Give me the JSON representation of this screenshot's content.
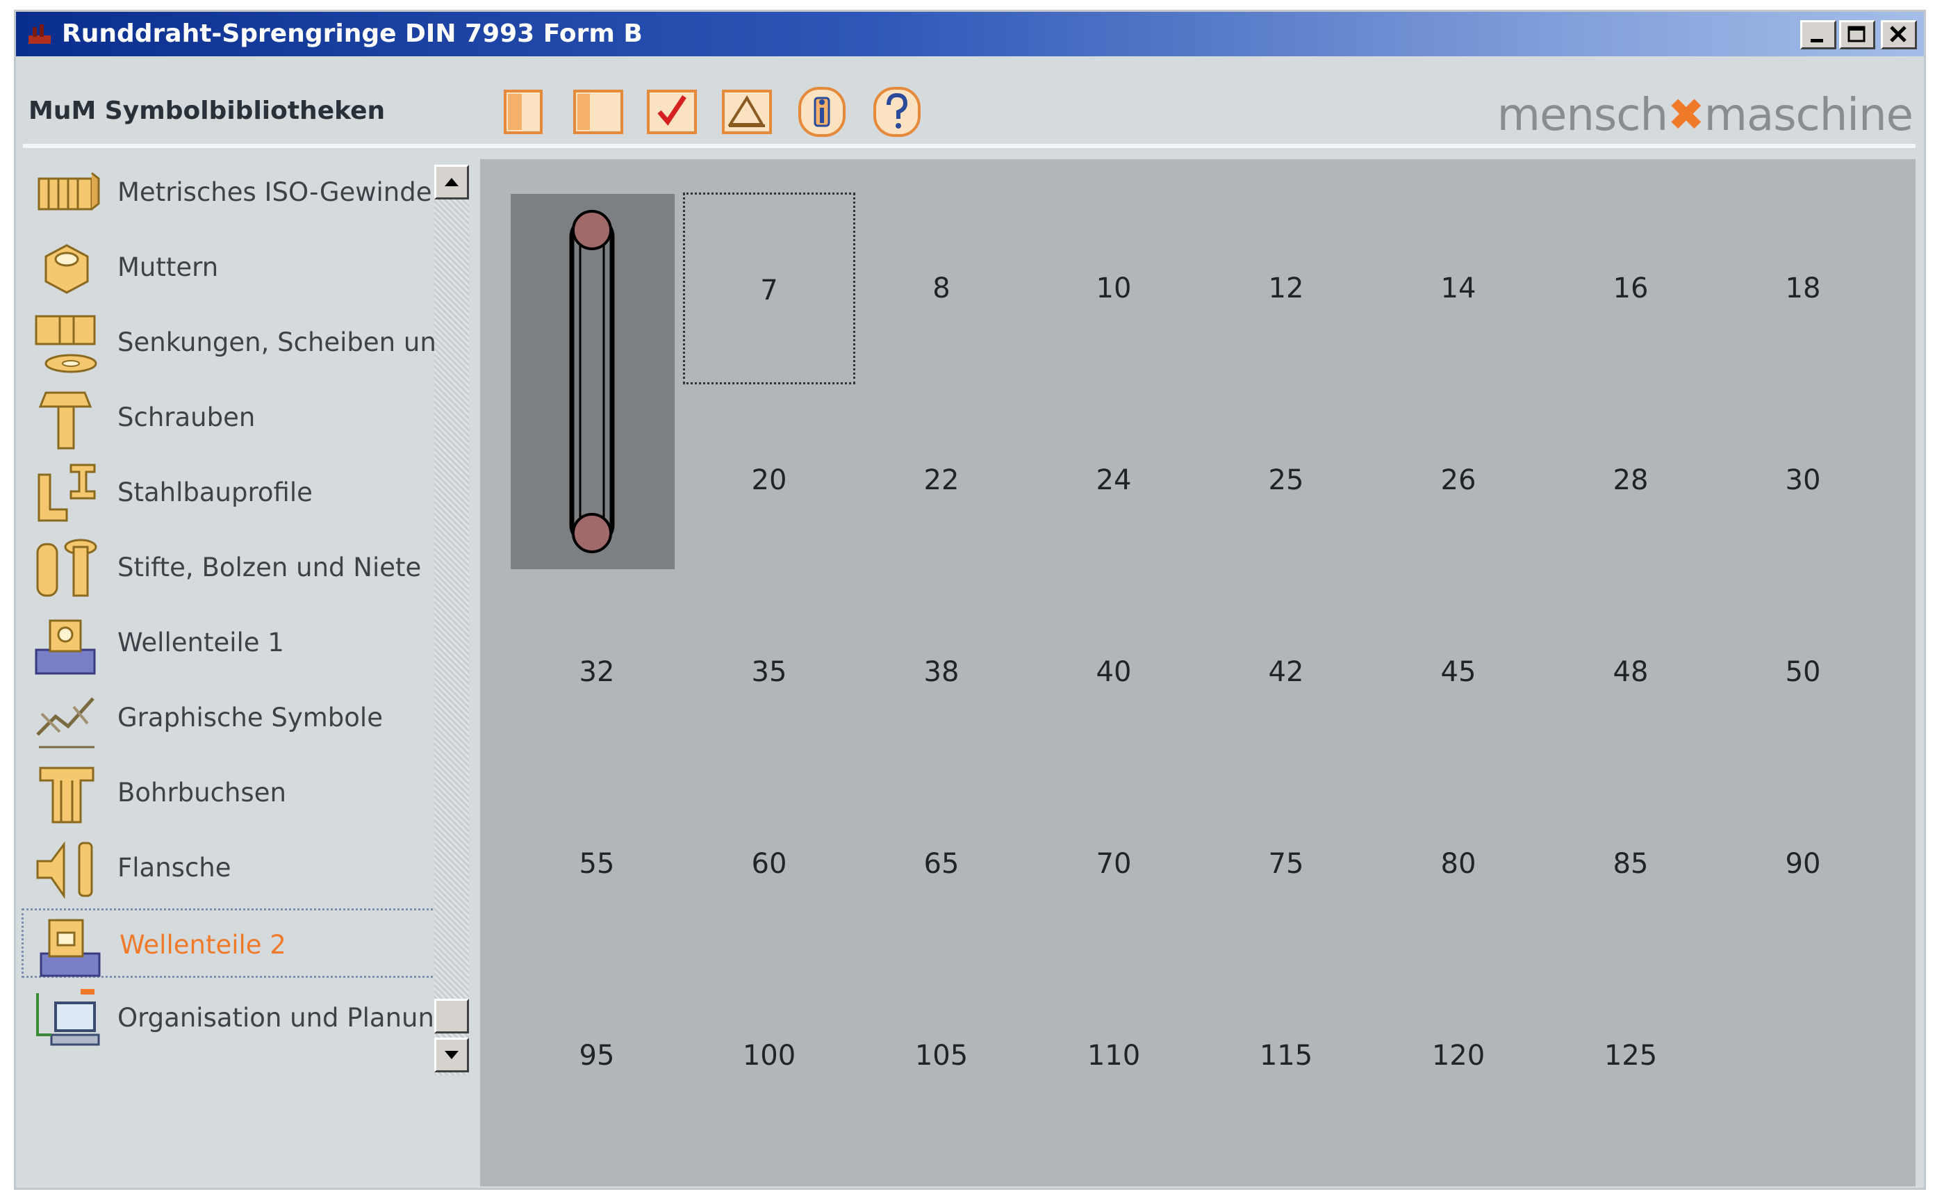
{
  "window": {
    "title": "Runddraht-Sprengringe DIN 7993 Form B",
    "controls": [
      "minimize",
      "maximize",
      "close"
    ]
  },
  "header": {
    "library_title": "MuM Symbolbibliotheken",
    "toolbar": [
      {
        "name": "single-view-icon"
      },
      {
        "name": "wide-view-icon"
      },
      {
        "name": "check-icon"
      },
      {
        "name": "drawing-icon"
      },
      {
        "name": "info-icon"
      },
      {
        "name": "help-icon"
      }
    ],
    "brand": {
      "left": "mensch",
      "right": "maschine"
    }
  },
  "sidebar": {
    "items": [
      {
        "label": "Metrisches ISO-Gewinde",
        "icon": "thread-icon"
      },
      {
        "label": "Muttern",
        "icon": "nut-icon"
      },
      {
        "label": "Senkungen, Scheiben und Du",
        "icon": "washer-icon"
      },
      {
        "label": "Schrauben",
        "icon": "screw-icon"
      },
      {
        "label": "Stahlbauprofile",
        "icon": "steel-profile-icon"
      },
      {
        "label": "Stifte, Bolzen und Niete",
        "icon": "pin-icon"
      },
      {
        "label": "Wellenteile 1",
        "icon": "shaft-part-icon"
      },
      {
        "label": "Graphische Symbole",
        "icon": "graphic-symbol-icon"
      },
      {
        "label": "Bohrbuchsen",
        "icon": "drill-bushing-icon"
      },
      {
        "label": "Flansche",
        "icon": "flange-icon"
      },
      {
        "label": "Wellenteile 2",
        "icon": "shaft-part-2-icon",
        "selected": true
      },
      {
        "label": "Organisation und Planung",
        "icon": "computer-icon"
      }
    ]
  },
  "grid": {
    "rows": [
      [
        "",
        "7",
        "8",
        "10",
        "12",
        "14",
        "16",
        "18"
      ],
      [
        "",
        "20",
        "22",
        "24",
        "25",
        "26",
        "28",
        "30"
      ],
      [
        "32",
        "35",
        "38",
        "40",
        "42",
        "45",
        "48",
        "50"
      ],
      [
        "55",
        "60",
        "65",
        "70",
        "75",
        "80",
        "85",
        "90"
      ],
      [
        "95",
        "100",
        "105",
        "110",
        "115",
        "120",
        "125",
        ""
      ]
    ],
    "focused": "7"
  },
  "colors": {
    "title_bar": "#0a2e8e",
    "accent": "#f07a2a",
    "panel": "#b1b6ba",
    "window": "#d5dadd"
  }
}
